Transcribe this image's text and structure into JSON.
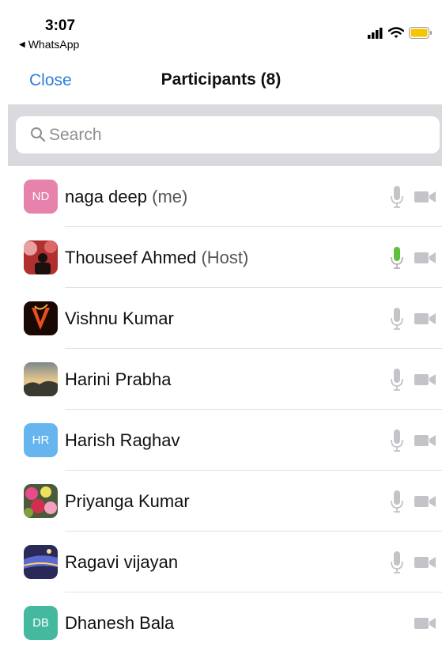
{
  "status_bar": {
    "time": "3:07",
    "back_app": "WhatsApp"
  },
  "nav": {
    "close_label": "Close",
    "title": "Participants (8)"
  },
  "search": {
    "placeholder": "Search",
    "value": ""
  },
  "participants": [
    {
      "name": "naga deep",
      "role": "(me)",
      "initials": "ND",
      "avatar_color": "#e682ab",
      "mic_active": false,
      "mic_visible": true
    },
    {
      "name": "Thouseef Ahmed",
      "role": "(Host)",
      "initials": "",
      "avatar_color": "#8a3a3a",
      "mic_active": true,
      "mic_visible": true
    },
    {
      "name": "Vishnu Kumar",
      "role": "",
      "initials": "",
      "avatar_color": "#5a1a0a",
      "mic_active": false,
      "mic_visible": true
    },
    {
      "name": "Harini Prabha",
      "role": "",
      "initials": "",
      "avatar_color": "#b89060",
      "mic_active": false,
      "mic_visible": true
    },
    {
      "name": "Harish Raghav",
      "role": "",
      "initials": "HR",
      "avatar_color": "#66b5ee",
      "mic_active": false,
      "mic_visible": true
    },
    {
      "name": "Priyanga Kumar",
      "role": "",
      "initials": "",
      "avatar_color": "#6a7a4a",
      "mic_active": false,
      "mic_visible": true
    },
    {
      "name": "Ragavi vijayan",
      "role": "",
      "initials": "",
      "avatar_color": "#3a3a6a",
      "mic_active": false,
      "mic_visible": true
    },
    {
      "name": "Dhanesh Bala",
      "role": "",
      "initials": "DB",
      "avatar_color": "#45b8a0",
      "mic_active": false,
      "mic_visible": false
    }
  ],
  "colors": {
    "accent": "#2f7de1",
    "mic_active": "#5fc13a",
    "icon_gray": "#c4c4c8",
    "battery": "#f7c400"
  },
  "icons": {
    "search": "search-icon",
    "mic": "microphone-icon",
    "camera": "video-camera-icon"
  }
}
